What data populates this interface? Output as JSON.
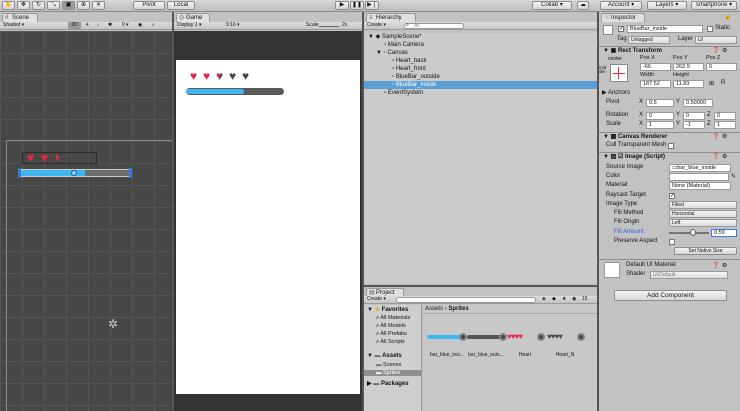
{
  "toolbar": {
    "pivot": "Pivot",
    "local": "Local",
    "collab": "Collab",
    "account": "Account",
    "layers": "Layers",
    "layout": "smartphone",
    "tools": [
      "hand-tool",
      "move-tool",
      "rotate-tool",
      "scale-tool",
      "rect-tool",
      "transform-tool",
      "custom-tool"
    ],
    "play_controls": [
      "play",
      "pause",
      "step"
    ]
  },
  "scene": {
    "tab": "Scene",
    "shading": "Shaded",
    "mode_2d": "2D",
    "hearts": [
      "full",
      "full",
      "half",
      "empty",
      "empty"
    ],
    "bar_fill": 0.59
  },
  "game": {
    "tab": "Game",
    "display": "Display 1",
    "aspect": "9:16",
    "scale_label": "Scale",
    "scale_value": "2x",
    "hearts": [
      "full",
      "full",
      "half",
      "empty",
      "empty"
    ],
    "bar_fill": 0.59
  },
  "hierarchy": {
    "tab": "Hierarchy",
    "create": "Create",
    "search_placeholder": "All",
    "items": [
      {
        "label": "SampleScene*"
      },
      {
        "label": "Main Camera"
      },
      {
        "label": "Canvas"
      },
      {
        "label": "Heart_back"
      },
      {
        "label": "Heart_front"
      },
      {
        "label": "BlueBar_outside"
      },
      {
        "label": "BlueBar_inside"
      },
      {
        "label": "EventSystem"
      }
    ]
  },
  "project": {
    "tab": "Project",
    "create": "Create",
    "count": "15",
    "favorites_label": "Favorites",
    "favorites": [
      "All Materials",
      "All Models",
      "All Prefabs",
      "All Scripts"
    ],
    "assets_label": "Assets",
    "folders": [
      "Scenes",
      "Sprites"
    ],
    "packages_label": "Packages",
    "breadcrumb": [
      "Assets",
      "Sprites"
    ],
    "assets": [
      "bar_blue_insi...",
      "bar_blue_outs...",
      "Heart",
      "Heart_N"
    ]
  },
  "inspector": {
    "tab": "Inspector",
    "object_name": "BlueBar_inside",
    "static_label": "Static",
    "tag_label": "Tag",
    "tag_value": "Untagged",
    "layer_label": "Layer",
    "layer_value": "UI",
    "rect_transform": {
      "title": "Rect Transform",
      "anchor_label": "center",
      "middle_label": "middle",
      "posx_label": "Pos X",
      "posy_label": "Pos Y",
      "posz_label": "Pos Z",
      "posx": "-66",
      "posy": "262.9",
      "posz": "0",
      "width_label": "Width",
      "height_label": "Height",
      "width": "187.52",
      "height": "11.83",
      "anchors_label": "Anchors",
      "pivot_label": "Pivot",
      "pivot_x": "0.5",
      "pivot_y": "0.50000",
      "rotation_label": "Rotation",
      "rot_x": "0",
      "rot_y": "0",
      "rot_z": "0",
      "scale_label": "Scale",
      "scale_x": "1",
      "scale_y": "-1",
      "scale_z": "1"
    },
    "canvas_renderer": {
      "title": "Canvas Renderer",
      "cull_label": "Cull Transparent Mesh"
    },
    "image": {
      "title": "Image (Script)",
      "source_label": "Source Image",
      "source_value": "bar_blue_inside",
      "color_label": "Color",
      "material_label": "Material",
      "material_value": "None (Material)",
      "raycast_label": "Raycast Target",
      "image_type_label": "Image Type",
      "image_type_value": "Filled",
      "fill_method_label": "Fill Method",
      "fill_method_value": "Horizontal",
      "fill_origin_label": "Fill Origin",
      "fill_origin_value": "Left",
      "fill_amount_label": "Fill Amount",
      "fill_amount_value": "0.59",
      "fill_amount": 0.59,
      "preserve_label": "Preserve Aspect",
      "native_size_button": "Set Native Size"
    },
    "material": {
      "name": "Default UI Material",
      "shader_label": "Shader",
      "shader_value": "UI/Default"
    },
    "add_component": "Add Component"
  },
  "colors": {
    "blue_bar": "#3fb7f0",
    "heart": "#e8264b",
    "heart_empty": "#4a4a4a",
    "selection": "#5a9fd6"
  }
}
